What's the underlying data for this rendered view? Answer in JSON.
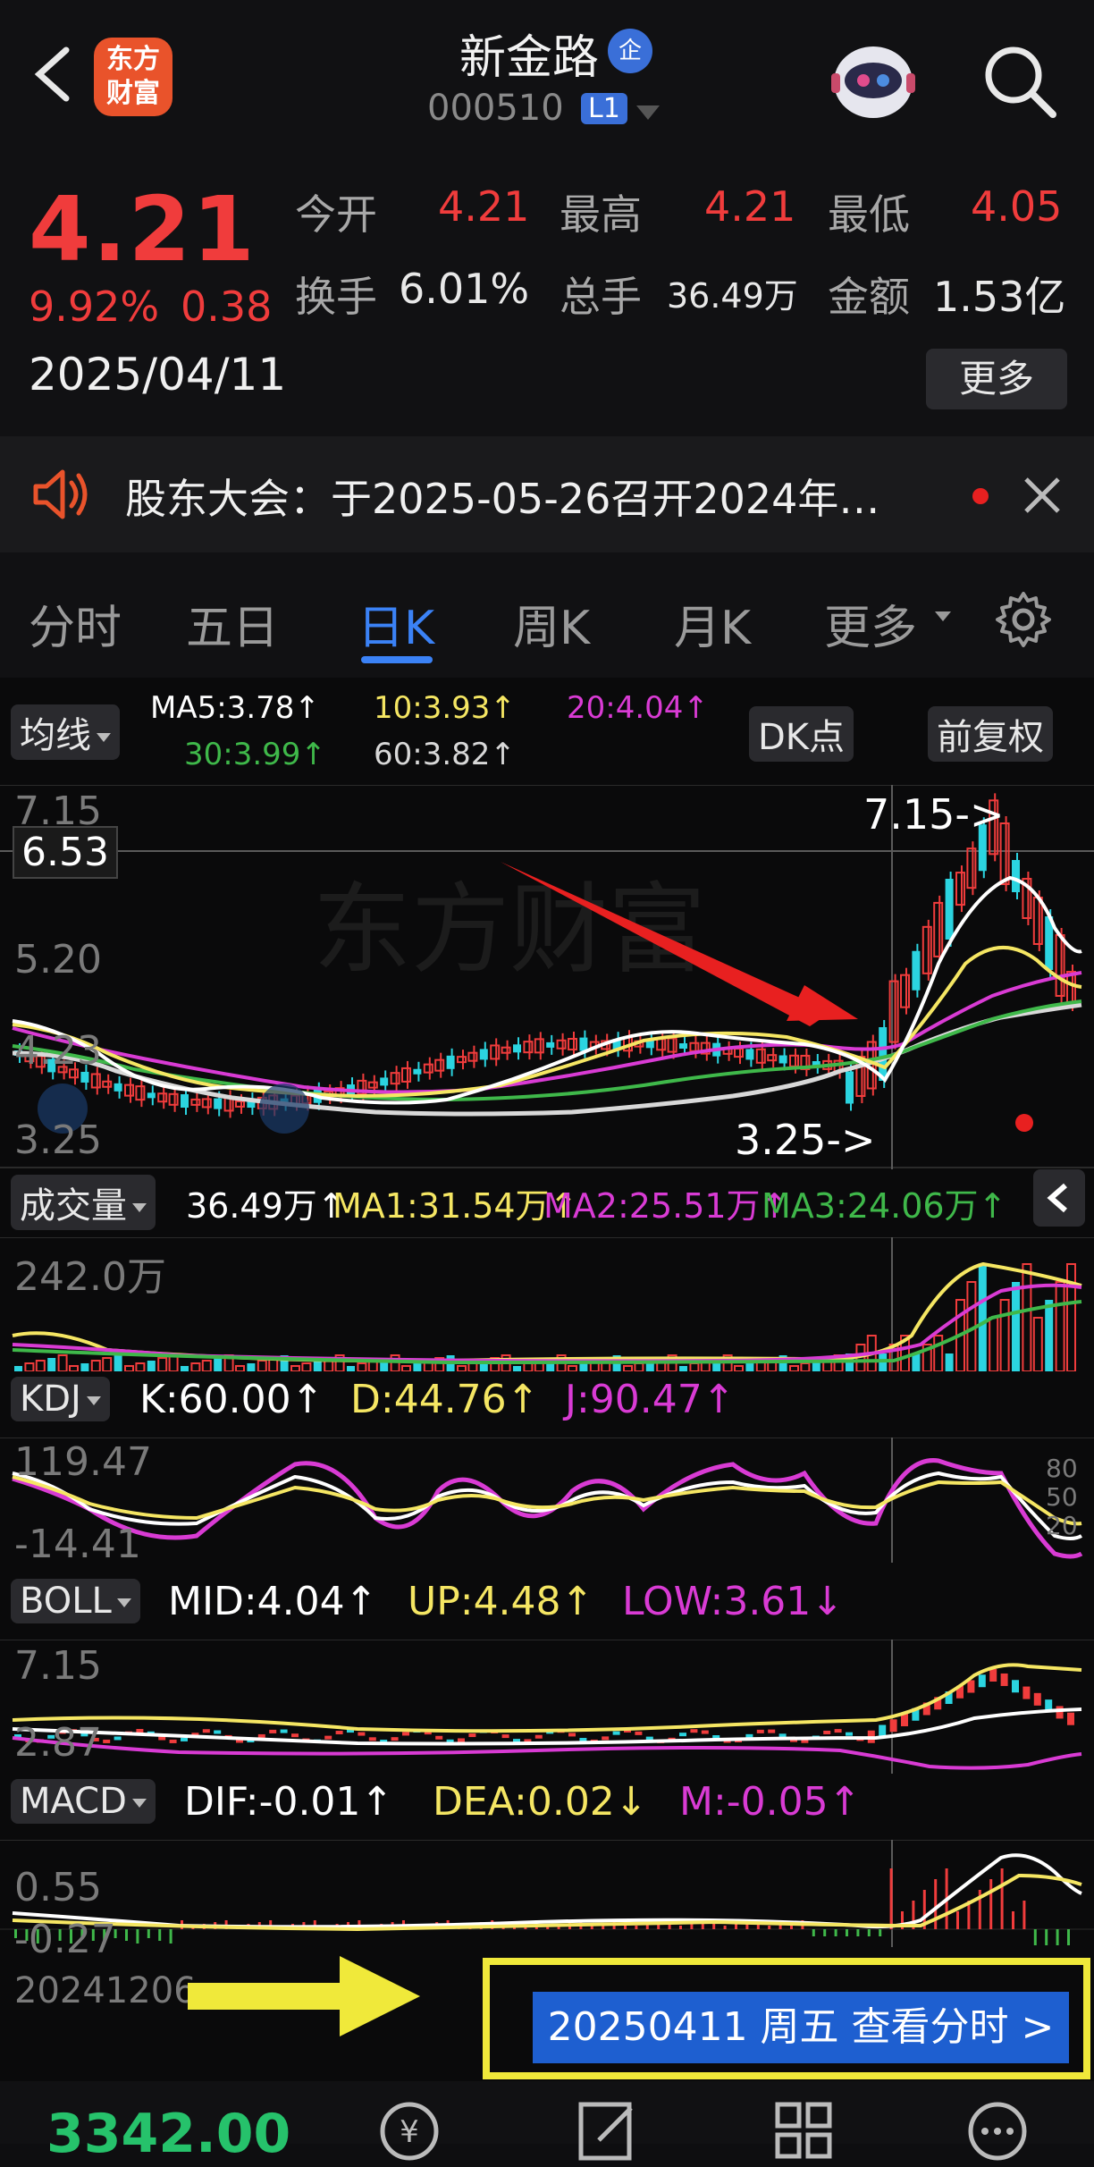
{
  "header": {
    "logo_text_1": "东方",
    "logo_text_2": "财富",
    "title": "新金路",
    "badge": "企",
    "code": "000510",
    "level": "L1",
    "icons": [
      "back-icon",
      "robot-avatar-icon",
      "search-icon"
    ]
  },
  "quote": {
    "price": "4.21",
    "change_pct": "9.92%",
    "change": "0.38",
    "date": "2025/04/11",
    "open_label": "今开",
    "open": "4.21",
    "high_label": "最高",
    "high": "4.21",
    "low_label": "最低",
    "low": "4.05",
    "turnover_label": "换手",
    "turnover": "6.01%",
    "volume_label": "总手",
    "volume": "36.49万",
    "amount_label": "金额",
    "amount": "1.53亿",
    "more_label": "更多"
  },
  "notice": {
    "text": "股东大会：于2025-05-26召开2024年…"
  },
  "tabs": {
    "items": [
      {
        "label": "分时"
      },
      {
        "label": "五日"
      },
      {
        "label": "日K"
      },
      {
        "label": "周K"
      },
      {
        "label": "月K"
      },
      {
        "label": "更多"
      }
    ],
    "active": "日K"
  },
  "kline": {
    "ma_selector": "均线",
    "ma5": "MA5:3.78↑",
    "ma10": "10:3.93↑",
    "ma20": "20:4.04↑",
    "ma30": "30:3.99↑",
    "ma60": "60:3.82↑",
    "dk_button": "DK点",
    "adjust_button": "前复权",
    "y_top": "7.15",
    "y_cursor": "6.53",
    "y_mid": "5.20",
    "y_low": "4.23",
    "y_bottom": "3.25",
    "annot_high": "7.15->",
    "annot_low": "3.25->",
    "watermark": "东方财富"
  },
  "volume": {
    "selector": "成交量",
    "v": "36.49万↑",
    "ma1": "MA1:31.54万↑",
    "ma2": "MA2:25.51万↑",
    "ma3": "MA3:24.06万↑",
    "y_top": "242.0万"
  },
  "kdj": {
    "selector": "KDJ",
    "k": "K:60.00↑",
    "d": "D:44.76↑",
    "j": "J:90.47↑",
    "y_top": "119.47",
    "y_bottom": "-14.41",
    "r80": "80",
    "r50": "50",
    "r20": "20"
  },
  "boll": {
    "selector": "BOLL",
    "mid": "MID:4.04↑",
    "up": "UP:4.48↑",
    "low": "LOW:3.61↓",
    "y_top": "7.15",
    "y_bottom": "2.87"
  },
  "macd": {
    "selector": "MACD",
    "dif": "DIF:-0.01↑",
    "dea": "DEA:0.02↓",
    "m": "M:-0.05↑",
    "y_top": "0.55",
    "y_bottom": "-0.27",
    "start_date": "20241206"
  },
  "detail_button": "20250411 周五 查看分时 >",
  "bottom": {
    "index_value": "3342.00"
  },
  "colors": {
    "up": "#f03c3c",
    "down": "#2bd4e0",
    "ma5": "#ffffff",
    "ma10": "#f5e663",
    "ma20": "#d93bd4",
    "ma30": "#3fb84a",
    "ma60": "#d8d8d8",
    "accent": "#3b82f6"
  }
}
